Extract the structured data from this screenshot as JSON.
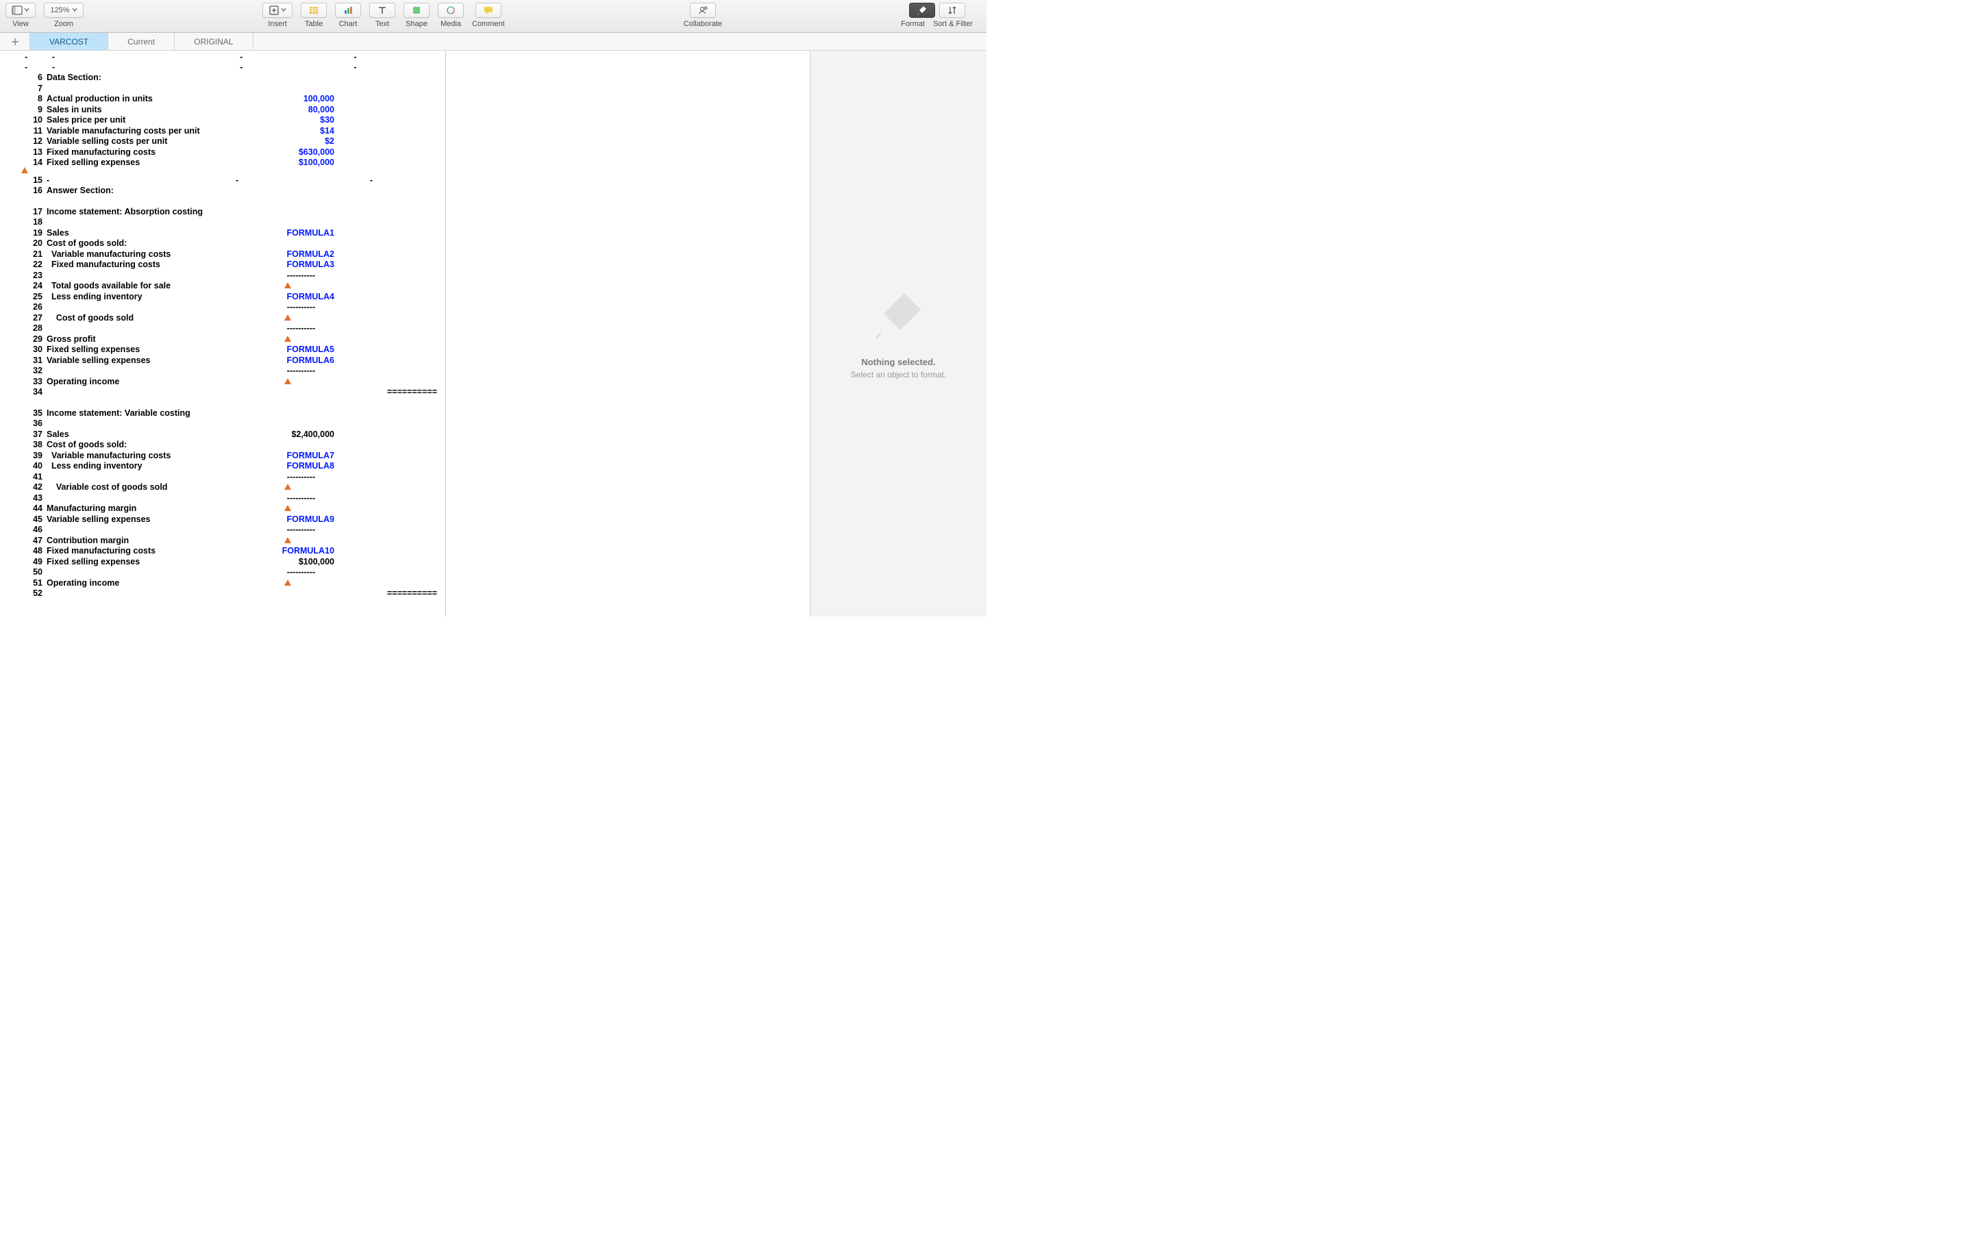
{
  "toolbar": {
    "view_label": "View",
    "zoom_label": "Zoom",
    "zoom_value": "125%",
    "insert_label": "Insert",
    "table_label": "Table",
    "chart_label": "Chart",
    "text_label": "Text",
    "shape_label": "Shape",
    "media_label": "Media",
    "comment_label": "Comment",
    "collaborate_label": "Collaborate",
    "format_label": "Format",
    "sort_filter_label": "Sort & Filter"
  },
  "tabs": {
    "t0": "VARCOST",
    "t1": "Current",
    "t2": "ORIGINAL"
  },
  "inspector": {
    "title": "Nothing selected.",
    "subtitle": "Select an object to format."
  },
  "rows": {
    "dash": "-",
    "r6": {
      "n": "6",
      "a": "Data Section:",
      "b": ""
    },
    "r7": {
      "n": "7",
      "a": "",
      "b": ""
    },
    "r8": {
      "n": "8",
      "a": "Actual production in units",
      "b": "100,000",
      "bt": "blue"
    },
    "r9": {
      "n": "9",
      "a": "Sales in units",
      "b": "80,000",
      "bt": "blue"
    },
    "r10": {
      "n": "10",
      "a": "Sales price per unit",
      "b": "$30",
      "bt": "blue"
    },
    "r11": {
      "n": "11",
      "a": "Variable manufacturing costs per unit",
      "b": "$14",
      "bt": "blue"
    },
    "r12": {
      "n": "12",
      "a": "Variable selling costs per unit",
      "b": "$2",
      "bt": "blue"
    },
    "r13": {
      "n": "13",
      "a": "Fixed manufacturing costs",
      "b": "$630,000",
      "bt": "blue"
    },
    "r14": {
      "n": "14",
      "a": "Fixed selling expenses",
      "b": "$100,000",
      "bt": "blue"
    },
    "r15": {
      "n": "15",
      "a": "-",
      "b": "-"
    },
    "r16": {
      "n": "16",
      "a": "Answer Section:",
      "b": ""
    },
    "r17": {
      "n": "17",
      "a": "Income statement: Absorption costing",
      "b": ""
    },
    "r18": {
      "n": "18",
      "a": "",
      "b": ""
    },
    "r19": {
      "n": "19",
      "a": "Sales",
      "b": "FORMULA1",
      "bt": "blue"
    },
    "r20": {
      "n": "20",
      "a": "Cost of goods sold:",
      "b": ""
    },
    "r21": {
      "n": "21",
      "a": "  Variable manufacturing costs",
      "b": "FORMULA2",
      "bt": "blue"
    },
    "r22": {
      "n": "22",
      "a": "  Fixed manufacturing costs",
      "b": "FORMULA3",
      "bt": "blue"
    },
    "r23": {
      "n": "23",
      "a": "",
      "b": "----------        "
    },
    "r24": {
      "n": "24",
      "a": "  Total goods available for sale",
      "b": "",
      "warn": true
    },
    "r25": {
      "n": "25",
      "a": "  Less ending inventory",
      "b": "FORMULA4",
      "bt": "blue"
    },
    "r26": {
      "n": "26",
      "a": "",
      "b": "----------        "
    },
    "r27": {
      "n": "27",
      "a": "    Cost of goods sold",
      "b": "",
      "warn": true
    },
    "r28": {
      "n": "28",
      "a": "",
      "b": "----------        "
    },
    "r29": {
      "n": "29",
      "a": "Gross profit",
      "b": "",
      "warn": true
    },
    "r30": {
      "n": "30",
      "a": "Fixed selling expenses",
      "b": "FORMULA5",
      "bt": "blue"
    },
    "r31": {
      "n": "31",
      "a": "Variable selling expenses",
      "b": "FORMULA6",
      "bt": "blue"
    },
    "r32": {
      "n": "32",
      "a": "",
      "b": "----------        "
    },
    "r33": {
      "n": "33",
      "a": "Operating income",
      "b": "",
      "warn": true
    },
    "r34": {
      "n": "34",
      "a": "",
      "b": "                              =========="
    },
    "r35": {
      "n": "35",
      "a": "Income statement: Variable costing",
      "b": ""
    },
    "r36": {
      "n": "36",
      "a": "",
      "b": ""
    },
    "r37": {
      "n": "37",
      "a": "Sales",
      "b": "$2,400,000",
      "bt": "black"
    },
    "r38": {
      "n": "38",
      "a": "Cost of goods sold:",
      "b": ""
    },
    "r39": {
      "n": "39",
      "a": "  Variable manufacturing costs",
      "b": "FORMULA7",
      "bt": "blue"
    },
    "r40": {
      "n": "40",
      "a": "  Less ending inventory",
      "b": "FORMULA8",
      "bt": "blue"
    },
    "r41": {
      "n": "41",
      "a": "",
      "b": "----------        "
    },
    "r42": {
      "n": "42",
      "a": "    Variable cost of goods sold",
      "b": "",
      "warn": true
    },
    "r43": {
      "n": "43",
      "a": "",
      "b": "----------        "
    },
    "r44": {
      "n": "44",
      "a": "Manufacturing margin",
      "b": "",
      "warn": true
    },
    "r45": {
      "n": "45",
      "a": "Variable selling expenses",
      "b": "FORMULA9",
      "bt": "blue"
    },
    "r46": {
      "n": "46",
      "a": "",
      "b": "----------        "
    },
    "r47": {
      "n": "47",
      "a": "Contribution margin",
      "b": "",
      "warn": true
    },
    "r48": {
      "n": "48",
      "a": "Fixed manufacturing costs",
      "b": "FORMULA10",
      "bt": "blue"
    },
    "r49": {
      "n": "49",
      "a": "Fixed selling expenses",
      "b": "$100,000",
      "bt": "black"
    },
    "r50": {
      "n": "50",
      "a": "",
      "b": "----------        "
    },
    "r51": {
      "n": "51",
      "a": "Operating income",
      "b": "",
      "warn": true
    },
    "r52": {
      "n": "52",
      "a": "",
      "b": "                              =========="
    }
  }
}
